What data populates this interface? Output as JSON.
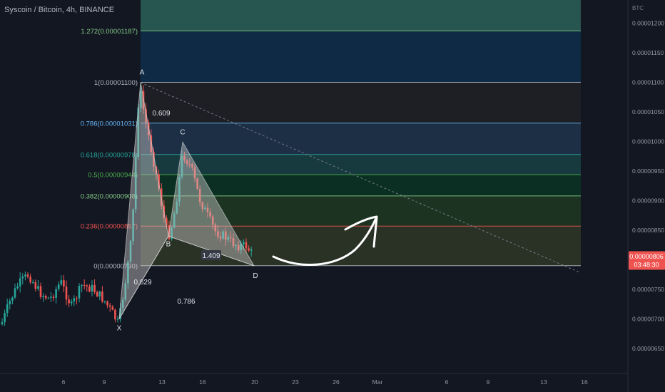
{
  "header": {
    "title": "Syscoin / Bitcoin, 4h, BINANCE"
  },
  "colors": {
    "background": "#131722",
    "up": "#26a69a",
    "down": "#ef5350",
    "text": "#b2b5be"
  },
  "chart_data": {
    "type": "candlestick",
    "price_axis": {
      "unit_label": "BTC",
      "ticks": [
        "0.00001200",
        "0.00001150",
        "0.00001100",
        "0.00001050",
        "0.00001000",
        "0.00000950",
        "0.00000900",
        "0.00000850",
        "0.00000800",
        "0.00000750",
        "0.00000700",
        "0.00000650"
      ],
      "range": [
        6.2e-06,
        1.255e-05
      ]
    },
    "time_axis": {
      "labels": [
        "6",
        "9",
        "13",
        "16",
        "20",
        "23",
        "26",
        "Mar",
        "6",
        "9",
        "13",
        "16"
      ]
    },
    "current_price": {
      "value": "0.00000806",
      "countdown": "03:48:30"
    },
    "fib_levels": [
      {
        "label": "1.272(0.00001187)",
        "value": 1.187e-05,
        "color": "#81c784"
      },
      {
        "label": "1(0.00001100)",
        "value": 1.1e-05,
        "color": "#b2b5be"
      },
      {
        "label": "0.786(0.00001031)",
        "value": 1.031e-05,
        "color": "#64b5f6"
      },
      {
        "label": "0.618(0.00000978)",
        "value": 9.78e-06,
        "color": "#26a69a"
      },
      {
        "label": "0.5(0.00000944)",
        "value": 9.44e-06,
        "color": "#4caf50"
      },
      {
        "label": "0.382(0.00000908)",
        "value": 9.08e-06,
        "color": "#81c784"
      },
      {
        "label": "0.236(0.00000857)",
        "value": 8.57e-06,
        "color": "#ef5350"
      },
      {
        "label": "0(0.00000790)",
        "value": 7.9e-06,
        "color": "#b2b5be"
      }
    ],
    "harmonic_pattern": {
      "points": [
        {
          "name": "X",
          "value": 7e-06
        },
        {
          "name": "A",
          "value": 1.1e-05
        },
        {
          "name": "B",
          "value": 8.4e-06
        },
        {
          "name": "C",
          "value": 9.99e-06
        },
        {
          "name": "D",
          "value": 7.9e-06
        }
      ],
      "ratios": [
        "0.609",
        "0.629",
        "0.786",
        "1.409"
      ]
    },
    "annotation": "hand-drawn curved arrow pointing up"
  }
}
